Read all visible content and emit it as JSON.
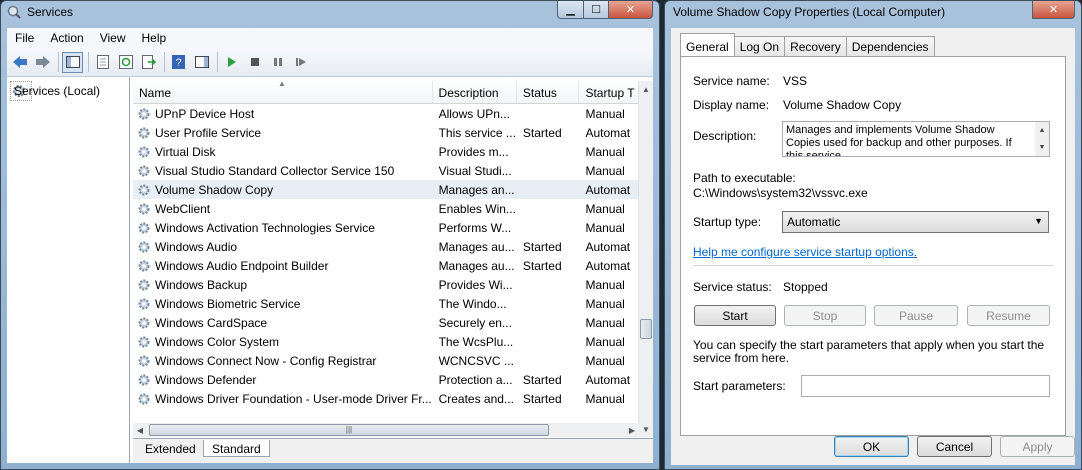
{
  "services_window": {
    "title": "Services",
    "menu": [
      "File",
      "Action",
      "View",
      "Help"
    ],
    "tree_item": "Services (Local)",
    "columns": [
      "Name",
      "Description",
      "Status",
      "Startup T"
    ],
    "rows": [
      {
        "name": "UPnP Device Host",
        "description": "Allows UPn...",
        "status": "",
        "startup": "Manual"
      },
      {
        "name": "User Profile Service",
        "description": "This service ...",
        "status": "Started",
        "startup": "Automat"
      },
      {
        "name": "Virtual Disk",
        "description": "Provides m...",
        "status": "",
        "startup": "Manual"
      },
      {
        "name": "Visual Studio Standard Collector Service 150",
        "description": "Visual Studi...",
        "status": "",
        "startup": "Manual"
      },
      {
        "name": "Volume Shadow Copy",
        "description": "Manages an...",
        "status": "",
        "startup": "Automat"
      },
      {
        "name": "WebClient",
        "description": "Enables Win...",
        "status": "",
        "startup": "Manual"
      },
      {
        "name": "Windows Activation Technologies Service",
        "description": "Performs W...",
        "status": "",
        "startup": "Manual"
      },
      {
        "name": "Windows Audio",
        "description": "Manages au...",
        "status": "Started",
        "startup": "Automat"
      },
      {
        "name": "Windows Audio Endpoint Builder",
        "description": "Manages au...",
        "status": "Started",
        "startup": "Automat"
      },
      {
        "name": "Windows Backup",
        "description": "Provides Wi...",
        "status": "",
        "startup": "Manual"
      },
      {
        "name": "Windows Biometric Service",
        "description": "The Windo...",
        "status": "",
        "startup": "Manual"
      },
      {
        "name": "Windows CardSpace",
        "description": "Securely en...",
        "status": "",
        "startup": "Manual"
      },
      {
        "name": "Windows Color System",
        "description": "The WcsPlu...",
        "status": "",
        "startup": "Manual"
      },
      {
        "name": "Windows Connect Now - Config Registrar",
        "description": "WCNCSVC ...",
        "status": "",
        "startup": "Manual"
      },
      {
        "name": "Windows Defender",
        "description": "Protection a...",
        "status": "Started",
        "startup": "Automat"
      },
      {
        "name": "Windows Driver Foundation - User-mode Driver Fr...",
        "description": "Creates and...",
        "status": "Started",
        "startup": "Manual"
      }
    ],
    "selected_row": 4,
    "bottom_tabs": [
      "Extended",
      "Standard"
    ]
  },
  "properties_dialog": {
    "title": "Volume Shadow Copy Properties (Local Computer)",
    "tabs": [
      "General",
      "Log On",
      "Recovery",
      "Dependencies"
    ],
    "service_name_label": "Service name:",
    "service_name": "VSS",
    "display_name_label": "Display name:",
    "display_name": "Volume Shadow Copy",
    "description_label": "Description:",
    "description": "Manages and implements Volume Shadow Copies used for backup and other purposes. If this service",
    "path_label": "Path to executable:",
    "path": "C:\\Windows\\system32\\vssvc.exe",
    "startup_type_label": "Startup type:",
    "startup_type": "Automatic",
    "help_link": "Help me configure service startup options.",
    "status_label": "Service status:",
    "status": "Stopped",
    "buttons": {
      "start": "Start",
      "stop": "Stop",
      "pause": "Pause",
      "resume": "Resume"
    },
    "params_hint": "You can specify the start parameters that apply when you start the service from here.",
    "params_label": "Start parameters:",
    "params_value": "",
    "footer": {
      "ok": "OK",
      "cancel": "Cancel",
      "apply": "Apply"
    }
  }
}
